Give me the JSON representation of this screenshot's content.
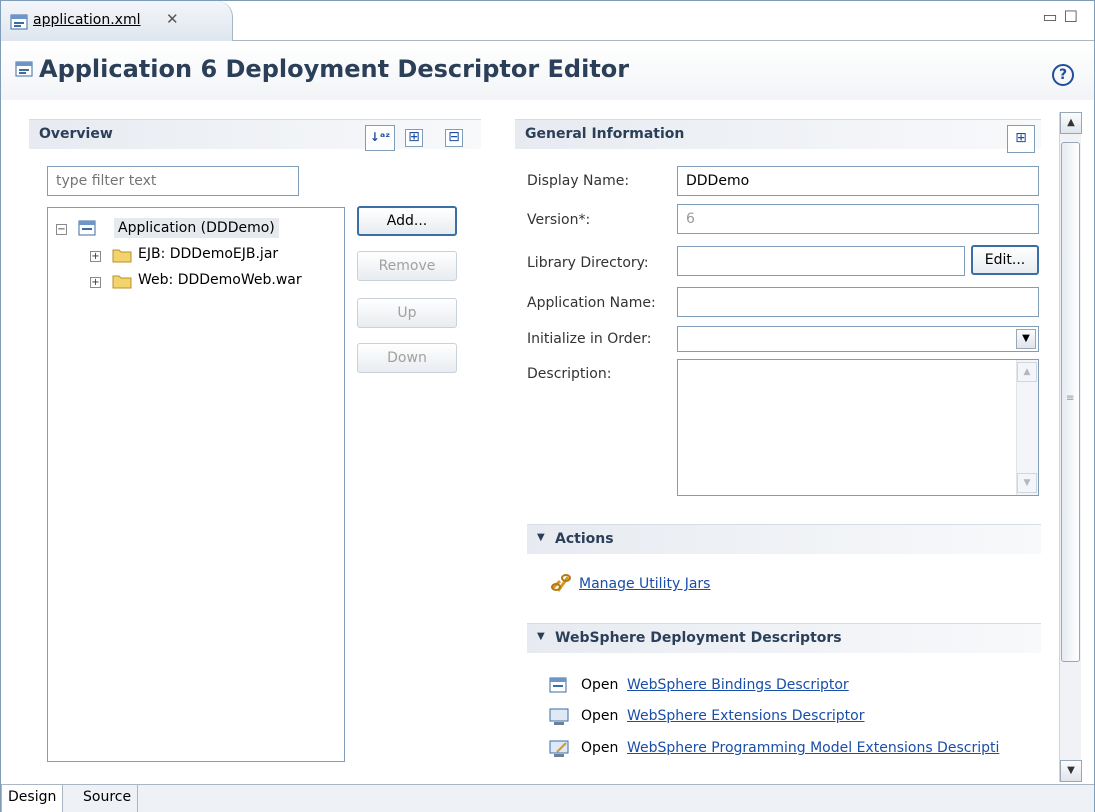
{
  "editor_tab": {
    "label": "application.xml",
    "close_glyph": "✕"
  },
  "window_controls": {
    "minimize": "▭",
    "maximize": "☐"
  },
  "header": {
    "title": "Application 6 Deployment Descriptor Editor",
    "help": "?"
  },
  "overview": {
    "title": "Overview",
    "filter_placeholder": "type filter text",
    "tree": {
      "root": "Application (DDDemo)",
      "children": [
        "EJB: DDDemoEJB.jar",
        "Web: DDDemoWeb.war"
      ]
    },
    "buttons": {
      "add": "Add...",
      "remove": "Remove",
      "up": "Up",
      "down": "Down"
    },
    "toolbar_icons": [
      "sort-az-icon",
      "expand-all-icon",
      "collapse-all-icon"
    ]
  },
  "general": {
    "title": "General Information",
    "display_name_label": "Display Name:",
    "display_name_value": "DDDemo",
    "version_label": "Version*:",
    "version_value": "6",
    "library_directory_label": "Library Directory:",
    "library_directory_value": "",
    "edit_button": "Edit...",
    "application_name_label": "Application Name:",
    "application_name_value": "",
    "initialize_label": "Initialize in Order:",
    "initialize_value": "",
    "description_label": "Description:",
    "description_value": ""
  },
  "actions": {
    "title": "Actions",
    "manage_utility_jars": "Manage Utility Jars"
  },
  "websphere": {
    "title": "WebSphere Deployment Descriptors",
    "open_prefix": "Open",
    "items": [
      {
        "icon": "bindings-descriptor-icon",
        "link": "WebSphere Bindings Descriptor"
      },
      {
        "icon": "extensions-descriptor-icon",
        "link": "WebSphere Extensions Descriptor"
      },
      {
        "icon": "programming-model-icon",
        "link": "WebSphere Programming Model Extensions Descripti"
      }
    ]
  },
  "bottom_tabs": {
    "design": "Design",
    "source": "Source"
  },
  "colors": {
    "accent": "#1f4e9c",
    "link": "#1a4ea8",
    "heading": "#2b3f58",
    "border": "#7f9db9"
  }
}
